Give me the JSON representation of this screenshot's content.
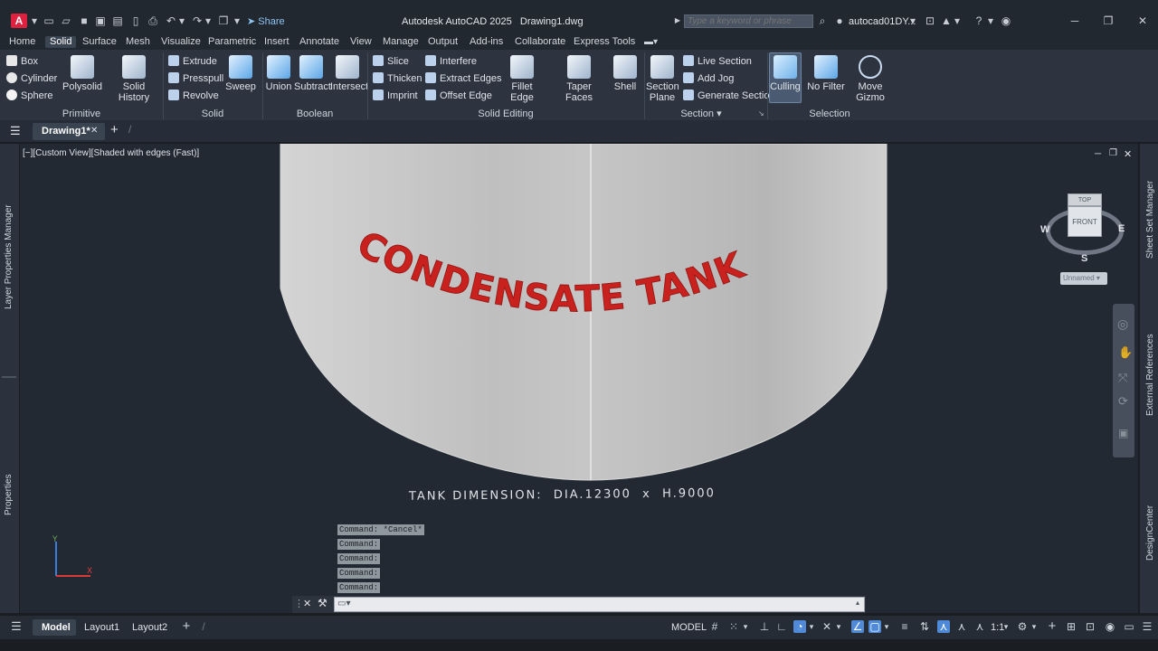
{
  "app": {
    "title": "Autodesk AutoCAD 2025",
    "file": "Drawing1.dwg",
    "logo": "A",
    "share": "Share",
    "search_placeholder": "Type a keyword or phrase",
    "user": "autocad01DY...",
    "accent": "#e0203f"
  },
  "ribbon_tabs": [
    "Home",
    "Solid",
    "Surface",
    "Mesh",
    "Visualize",
    "Parametric",
    "Insert",
    "Annotate",
    "View",
    "Manage",
    "Output",
    "Add-ins",
    "Collaborate",
    "Express Tools"
  ],
  "active_tab": "Solid",
  "ribbon": {
    "primitive": {
      "items": [
        "Box",
        "Cylinder",
        "Sphere"
      ],
      "big": [
        "Polysolid",
        "Solid History"
      ],
      "label": "Primitive"
    },
    "solid": {
      "small": [
        "Extrude",
        "Presspull",
        "Revolve"
      ],
      "big": "Sweep",
      "label": "Solid"
    },
    "boolean": {
      "big": [
        "Union",
        "Subtract",
        "Intersect"
      ],
      "label": "Boolean"
    },
    "solid_editing": {
      "small_a": [
        "Slice",
        "Thicken",
        "Imprint"
      ],
      "small_b": [
        "Interfere",
        "Extract Edges",
        "Offset Edge"
      ],
      "big": [
        "Fillet Edge",
        "Taper Faces",
        "Shell"
      ],
      "label": "Solid Editing"
    },
    "section": {
      "big": [
        "Section",
        "Plane"
      ],
      "small": [
        "Live Section",
        "Add Jog",
        "Generate Section"
      ],
      "label": "Section"
    },
    "selection": {
      "big": [
        "Culling",
        "No Filter",
        "Move",
        "Gizmo"
      ],
      "label": "Selection"
    }
  },
  "doc_tab": "Drawing1*",
  "viewport": {
    "label": "[−][Custom View][Shaded with edges (Fast)]",
    "tank_text": "CONDENSATE TANK",
    "dimension_text": "TANK DIMENSION:  DIA.12300  x  H.9000",
    "tank_color": "#bdbdbd",
    "text_color": "#c8211e"
  },
  "viewcube": {
    "top": "TOP",
    "front": "FRONT",
    "w": "W",
    "e": "E",
    "s": "S",
    "ucs": "Unnamed"
  },
  "side_panels": {
    "left": [
      "Layer Properties Manager",
      "Properties"
    ],
    "right": [
      "Sheet Set Manager",
      "External References",
      "DesignCenter"
    ]
  },
  "command_history": [
    "Command: *Cancel*",
    "Command:",
    "Command:",
    "Command:",
    "Command:"
  ],
  "status": {
    "layout_tabs": [
      "Model",
      "Layout1",
      "Layout2"
    ],
    "model_label": "MODEL",
    "scale": "1:1"
  }
}
